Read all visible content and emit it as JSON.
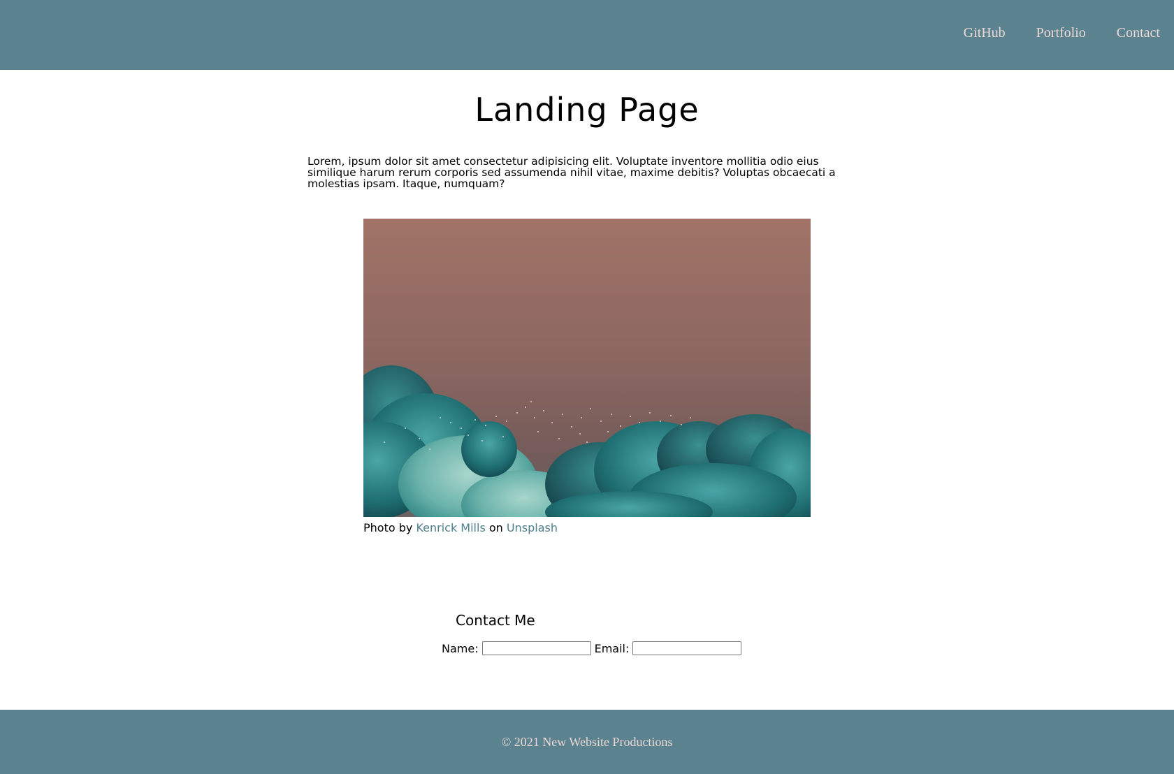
{
  "header": {
    "nav": [
      {
        "label": "GitHub"
      },
      {
        "label": "Portfolio"
      },
      {
        "label": "Contact"
      }
    ]
  },
  "main": {
    "title": "Landing Page",
    "intro": "Lorem, ipsum dolor sit amet consectetur adipisicing elit. Voluptate inventore mollitia odio eius similique harum rerum corporis sed assumenda nihil vitae, maxime debitis? Voluptas obcaecati a molestias ipsam. Itaque, numquam?",
    "caption": {
      "prefix": "Photo by",
      "author": "Kenrick Mills",
      "middle": "on",
      "site": "Unsplash"
    }
  },
  "contact": {
    "title": "Contact Me",
    "name_label": "Name:",
    "name_value": "",
    "email_label": "Email:",
    "email_value": ""
  },
  "footer": {
    "text": "© 2021 New Website Productions"
  },
  "colors": {
    "header_bg": "#5a828f",
    "nav_text": "#ecd9d6",
    "link": "#4f7f8c"
  }
}
